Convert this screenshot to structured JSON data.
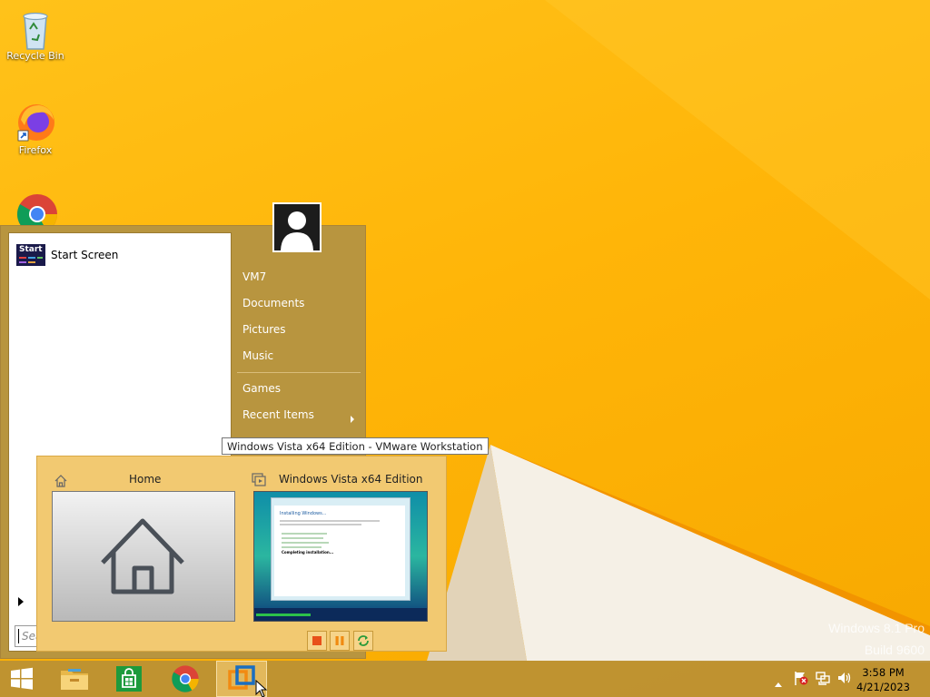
{
  "desktop": {
    "icons": [
      {
        "label": "Recycle Bin",
        "icon": "recycle-bin-icon"
      },
      {
        "label": "Firefox",
        "icon": "firefox-icon"
      },
      {
        "label": "",
        "icon": "chrome-icon"
      }
    ],
    "watermark": {
      "line1": "Windows 8.1 Pro",
      "line2": "Build 9600"
    }
  },
  "start_menu": {
    "pinned": [
      {
        "label": "Start Screen",
        "tile_text": "Start"
      }
    ],
    "right_links": [
      "VM7",
      "Documents",
      "Pictures",
      "Music",
      "Games",
      "Recent Items"
    ],
    "search_placeholder": "Search"
  },
  "tooltip": {
    "text": "Windows Vista x64 Edition - VMware Workstation"
  },
  "thumbnail_popup": {
    "tabs": [
      {
        "title": "Home",
        "icon": "home-icon"
      },
      {
        "title": "Windows Vista x64 Edition",
        "icon": "vm-icon"
      }
    ],
    "installer_lines": [
      "Installing Windows...",
      "Completing installation..."
    ],
    "controls": [
      "stop-icon",
      "pause-icon",
      "restart-icon"
    ]
  },
  "taskbar": {
    "buttons": [
      "start-button",
      "file-explorer",
      "windows-store",
      "chrome",
      "vmware-workstation"
    ],
    "clock": {
      "time": "3:58 PM",
      "date": "4/21/2023"
    }
  },
  "colors": {
    "accent": "#ffb508",
    "menu": "#b8953f",
    "popup": "#f2c971",
    "taskbar": "#ba9034"
  }
}
